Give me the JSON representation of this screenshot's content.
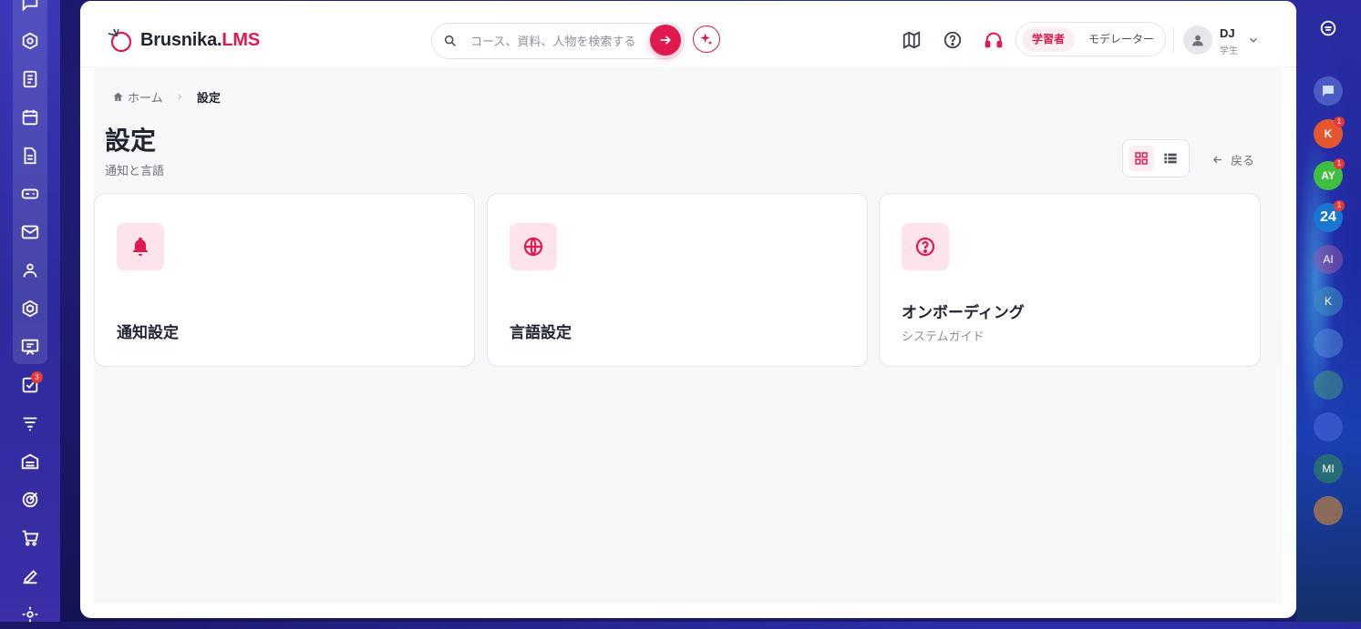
{
  "brand": {
    "name": "Brusnika.",
    "accent": "LMS",
    "accent_color": "#e01a4f"
  },
  "search": {
    "placeholder": "コース、資料、人物を検索する"
  },
  "header_icons": [
    "map-icon",
    "help-icon",
    "support-icon"
  ],
  "roles": {
    "learner": "学習者",
    "moderator": "モデレーター"
  },
  "user": {
    "initials": "DJ",
    "role": "学生"
  },
  "breadcrumb": {
    "home": "ホーム",
    "current": "設定"
  },
  "page": {
    "title": "設定",
    "subtitle": "通知と言語"
  },
  "back_label": "戻る",
  "cards": [
    {
      "title": "通知設定",
      "icon": "bell-icon"
    },
    {
      "title": "言語設定",
      "icon": "globe-icon"
    },
    {
      "title": "オンボーディング",
      "subtitle": "システムガイド",
      "icon": "question-icon"
    }
  ],
  "left_rail": {
    "icons": [
      "chat-icon",
      "course-compass-icon",
      "notes-icon",
      "calendar-icon",
      "document-icon",
      "gamepad-icon",
      "mail-icon",
      "people-icon",
      "hexagon-icon",
      "presentation-icon",
      "tasks-icon",
      "filter-icon",
      "warehouse-icon",
      "target-icon",
      "cart-icon",
      "edit-icon",
      "settings-icon"
    ],
    "tasks_badge": "3"
  },
  "right_rail": {
    "avatars": [
      {
        "label": "K",
        "badge": "1",
        "color": "#e4572e"
      },
      {
        "label": "AY",
        "badge": "1",
        "color": "#3fbf3f"
      },
      {
        "label": "24",
        "badge": "1",
        "color": "#1976d2"
      },
      {
        "label": "AI",
        "color": "#7a5aa8"
      },
      {
        "label": "K",
        "color": "#2f7fb0"
      },
      {
        "label": "MI",
        "color": "#2e8b57"
      }
    ]
  }
}
